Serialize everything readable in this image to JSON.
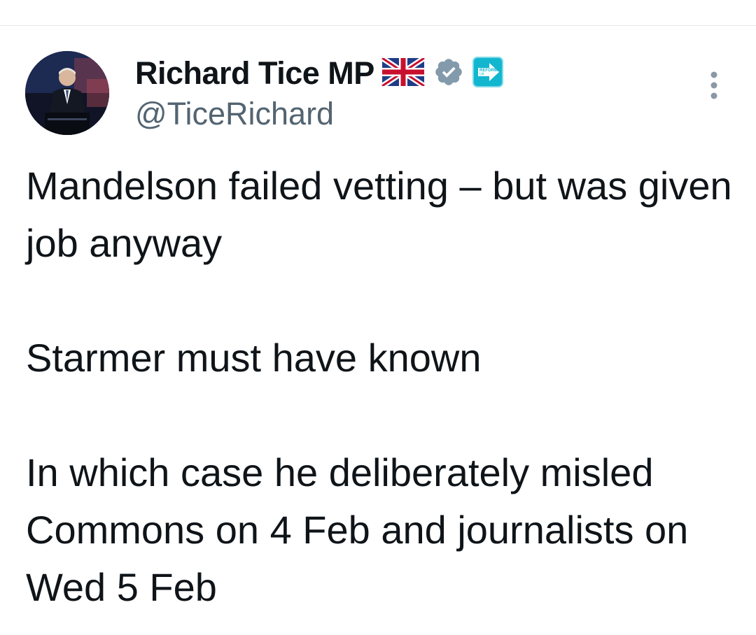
{
  "tweet": {
    "author": {
      "display_name": "Richard Tice MP",
      "handle": "@TiceRichard",
      "avatar_icon": "avatar-photo",
      "badges": [
        "uk-flag-icon",
        "verified-badge-icon",
        "reform-uk-logo-icon"
      ],
      "verified_badge_color": "#829aab",
      "reform_logo_color": "#12b6cf",
      "reform_logo_text": "REFORM UK"
    },
    "more_icon": "more-vertical-icon",
    "text": {
      "paragraph_1": "Mandelson failed vetting – but was given job anyway",
      "paragraph_2": "Starmer must have known",
      "paragraph_3": "In which case he deliberately misled Commons on 4 Feb and journalists on Wed 5 Feb"
    }
  },
  "colors": {
    "text_primary": "#0f1419",
    "text_secondary": "#536471",
    "divider": "#e7e9ea"
  }
}
